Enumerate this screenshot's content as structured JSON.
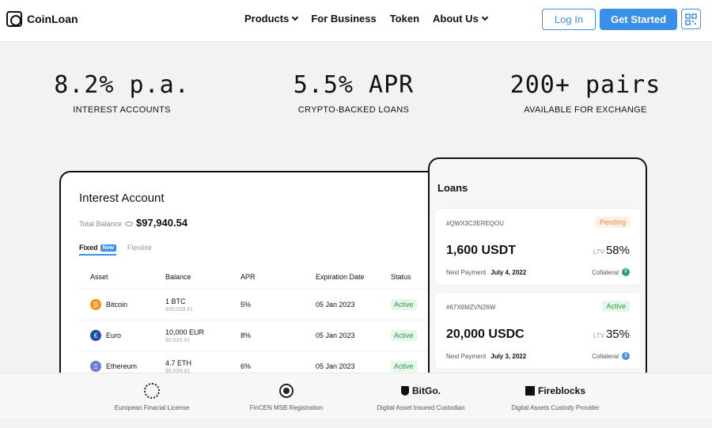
{
  "header": {
    "brand": "CoinLoan",
    "nav": [
      {
        "label": "Products",
        "dropdown": true
      },
      {
        "label": "For Business",
        "dropdown": false
      },
      {
        "label": "Token",
        "dropdown": false
      },
      {
        "label": "About Us",
        "dropdown": true
      }
    ],
    "login_label": "Log In",
    "get_started_label": "Get Started",
    "accent_color": "#3a8fe8"
  },
  "stats": [
    {
      "value": "8.2% p.a.",
      "label": "INTEREST ACCOUNTS"
    },
    {
      "value": "5.5% APR",
      "label": "CRYPTO-BACKED LOANS"
    },
    {
      "value": "200+ pairs",
      "label": "AVAILABLE FOR EXCHANGE"
    }
  ],
  "interest_account": {
    "title": "Interest Account",
    "total_balance_label": "Total Balance",
    "total_balance": "$97,940.54",
    "tabs": {
      "fixed": "Fixed",
      "new": "New",
      "flexible": "Flexible"
    },
    "columns": [
      "Asset",
      "Balance",
      "APR",
      "Expiration Date",
      "Status"
    ],
    "rows": [
      {
        "asset": "Bitcoin",
        "icon": "bitcoin-icon",
        "color": "#f7931a",
        "glyph": "₿",
        "balance": "1 BTC",
        "fiat": "$30,039.81",
        "apr": "5%",
        "expiration": "05 Jan 2023",
        "status": "Active"
      },
      {
        "asset": "Euro",
        "icon": "euro-icon",
        "color": "#1e4fa8",
        "glyph": "€",
        "balance": "10,000 EUR",
        "fiat": "$9,839.81",
        "apr": "8%",
        "expiration": "05 Jan 2023",
        "status": "Active"
      },
      {
        "asset": "Ethereum",
        "icon": "ethereum-icon",
        "color": "#6c7fd8",
        "glyph": "Ξ",
        "balance": "4.7 ETH",
        "fiat": "$6,039.81",
        "apr": "6%",
        "expiration": "05 Jan 2023",
        "status": "Active"
      }
    ]
  },
  "loans": {
    "title": "Loans",
    "items": [
      {
        "id": "#QWX3C3EREQOU",
        "status": "Pending",
        "status_color": "#f0883e",
        "status_bg": "#fdf0e4",
        "amount": "1,600 USDT",
        "ltv_label": "LTV",
        "ltv": "58%",
        "next_payment_label": "Next Payment",
        "next_payment": "July 4, 2022",
        "collateral_label": "Collateral",
        "collateral_color": "#26a17b",
        "collateral_glyph": "₮"
      },
      {
        "id": "#67X6MZVN26W",
        "status": "Active",
        "status_color": "#2e9a4a",
        "status_bg": "#e5f7e8",
        "amount": "20,000 USDC",
        "ltv_label": "LTV",
        "ltv": "35%",
        "next_payment_label": "Next Payment",
        "next_payment": "July 3, 2022",
        "collateral_label": "Collateral",
        "collateral_color": "#4a90d9",
        "collateral_glyph": "$"
      }
    ]
  },
  "badges": [
    {
      "logo_text": "",
      "label": "European Finacial License",
      "icon": "eu-stars-icon"
    },
    {
      "logo_text": "",
      "label": "FinCEN MSB Registration",
      "icon": "fincen-seal-icon"
    },
    {
      "logo_text": "BitGo.",
      "label": "Digital Asset Insured Custodian",
      "icon": "bitgo-shield-icon"
    },
    {
      "logo_text": "Fireblocks",
      "label": "Digital Assets Custody Provider",
      "icon": "fireblocks-icon"
    }
  ]
}
